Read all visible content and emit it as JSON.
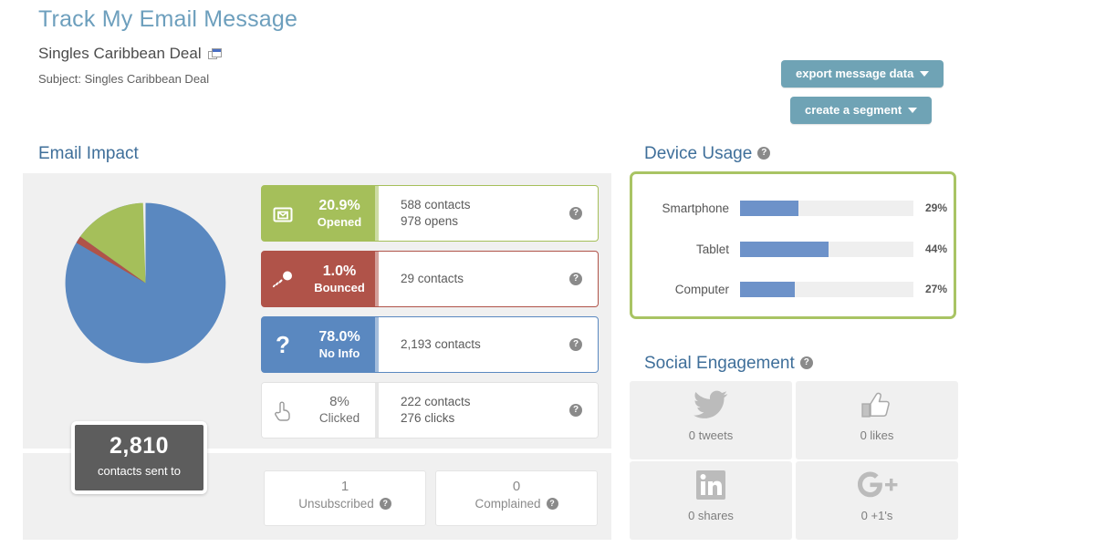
{
  "header": {
    "page_title": "Track My Email Message",
    "message_name": "Singles Caribbean Deal",
    "copy_icon": "copy-windows-icon",
    "subject": "Subject: Singles Caribbean Deal",
    "export_button": "export message data",
    "segment_button": "create a segment"
  },
  "sections": {
    "email_impact": "Email Impact",
    "device_usage": "Device Usage",
    "social_engagement": "Social Engagement"
  },
  "email_impact": {
    "sent": {
      "count": "2,810",
      "label": "contacts sent to"
    },
    "rows": [
      {
        "icon": "open-envelope-icon",
        "percent": "20.9%",
        "label": "Opened",
        "detail_line1": "588 contacts",
        "detail_line2": "978 opens",
        "color": "#a5bf5a",
        "help": "?"
      },
      {
        "icon": "bouncing-ball-icon",
        "percent": "1.0%",
        "label": "Bounced",
        "detail_line1": "29 contacts",
        "detail_line2": "",
        "color": "#b05349",
        "help": "?"
      },
      {
        "icon": "question-mark-icon",
        "percent": "78.0%",
        "label": "No Info",
        "detail_line1": "2,193 contacts",
        "detail_line2": "",
        "color": "#5a88c0",
        "help": "?"
      },
      {
        "icon": "pointing-hand-icon",
        "percent": "8%",
        "label": "Clicked",
        "detail_line1": "222 contacts",
        "detail_line2": "276 clicks",
        "color": "#ffffff",
        "help": "?"
      }
    ],
    "mini_cards": [
      {
        "number": "1",
        "label": "Unsubscribed",
        "help": "?"
      },
      {
        "number": "0",
        "label": "Complained",
        "help": "?"
      }
    ]
  },
  "chart_data": {
    "type": "pie",
    "title": "Email Impact",
    "categories": [
      "No Info",
      "Opened",
      "Bounced"
    ],
    "values": [
      78.0,
      20.9,
      1.0
    ],
    "colors": [
      "#5a88c0",
      "#a5bf5a",
      "#b05349"
    ],
    "unit": "%",
    "legend": "none",
    "total_contacts": 2810
  },
  "device_usage": {
    "help": "?",
    "bars": [
      {
        "label": "Smartphone",
        "percent": 29,
        "display": "29%"
      },
      {
        "label": "Tablet",
        "percent": 44,
        "display": "44%"
      },
      {
        "label": "Computer",
        "percent": 27,
        "display": "27%"
      }
    ],
    "bar_color": "#6d92c9",
    "track_color": "#efefef",
    "border_color": "#a9c464"
  },
  "social_engagement": {
    "help": "?",
    "cards": [
      {
        "icon": "twitter-bird-icon",
        "label": "0 tweets"
      },
      {
        "icon": "thumbs-up-icon",
        "label": "0 likes"
      },
      {
        "icon": "linkedin-icon",
        "label": "0 shares"
      },
      {
        "icon": "google-plus-icon",
        "label": "0 +1's"
      }
    ]
  },
  "colors": {
    "accent_teal": "#6fa3b5",
    "heading_blue": "#3f6f9a",
    "title_blue": "#6d9fbd",
    "green": "#a5bf5a",
    "red": "#b05349",
    "blue": "#5a88c0",
    "panel_grey": "#f0f0f0"
  }
}
